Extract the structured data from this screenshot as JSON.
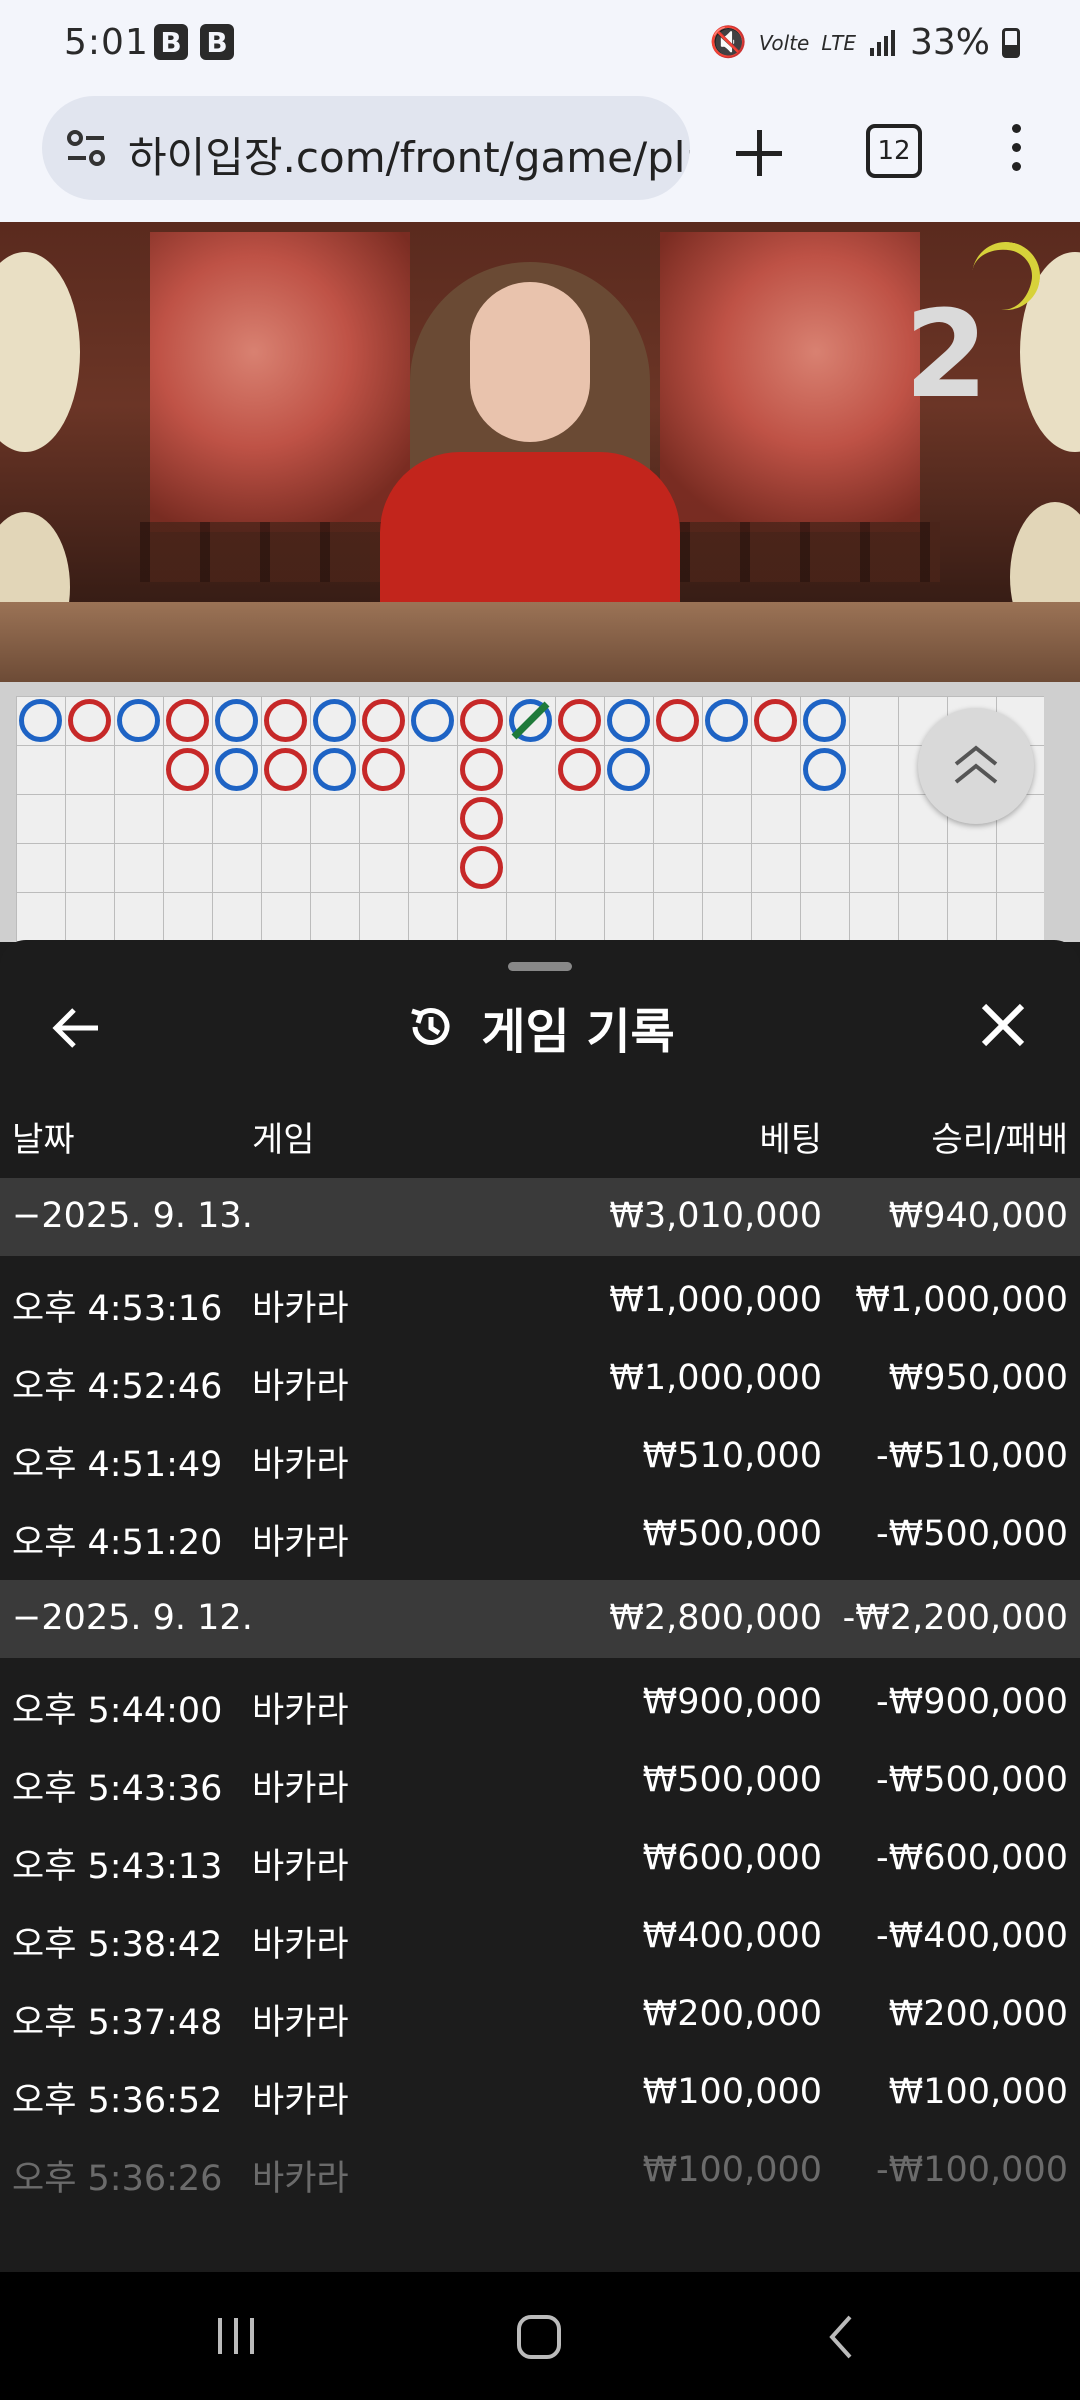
{
  "status_bar": {
    "time": "5:01",
    "b1": "B",
    "b2": "B",
    "volte": "Volte",
    "lte": "LTE",
    "battery": "33%"
  },
  "browser": {
    "url": "하이입장.com/front/game/pla",
    "tab_count": "12"
  },
  "video": {
    "round_number": "2"
  },
  "sheet": {
    "title": "게임 기록",
    "columns": {
      "date": "날짜",
      "game": "게임",
      "bet": "베팅",
      "win_loss": "승리/패배"
    },
    "groups": [
      {
        "date": "−2025. 9. 13.",
        "bet_total": "₩3,010,000",
        "wl_total": "₩940,000",
        "rows": [
          {
            "time": "오후 4:53:16",
            "game": "바카라",
            "bet": "₩1,000,000",
            "wl": "₩1,000,000"
          },
          {
            "time": "오후 4:52:46",
            "game": "바카라",
            "bet": "₩1,000,000",
            "wl": "₩950,000"
          },
          {
            "time": "오후 4:51:49",
            "game": "바카라",
            "bet": "₩510,000",
            "wl": "-₩510,000"
          },
          {
            "time": "오후 4:51:20",
            "game": "바카라",
            "bet": "₩500,000",
            "wl": "-₩500,000"
          }
        ]
      },
      {
        "date": "−2025. 9. 12.",
        "bet_total": "₩2,800,000",
        "wl_total": "-₩2,200,000",
        "rows": [
          {
            "time": "오후 5:44:00",
            "game": "바카라",
            "bet": "₩900,000",
            "wl": "-₩900,000"
          },
          {
            "time": "오후 5:43:36",
            "game": "바카라",
            "bet": "₩500,000",
            "wl": "-₩500,000"
          },
          {
            "time": "오후 5:43:13",
            "game": "바카라",
            "bet": "₩600,000",
            "wl": "-₩600,000"
          },
          {
            "time": "오후 5:38:42",
            "game": "바카라",
            "bet": "₩400,000",
            "wl": "-₩400,000"
          },
          {
            "time": "오후 5:37:48",
            "game": "바카라",
            "bet": "₩200,000",
            "wl": "₩200,000"
          },
          {
            "time": "오후 5:36:52",
            "game": "바카라",
            "bet": "₩100,000",
            "wl": "₩100,000"
          },
          {
            "time": "오후 5:36:26",
            "game": "바카라",
            "bet": "₩100,000",
            "wl": "-₩100,000"
          }
        ]
      }
    ]
  },
  "colors": {
    "banker": "#c62828",
    "player": "#1e63c4",
    "tie": "#1f7a3a"
  }
}
